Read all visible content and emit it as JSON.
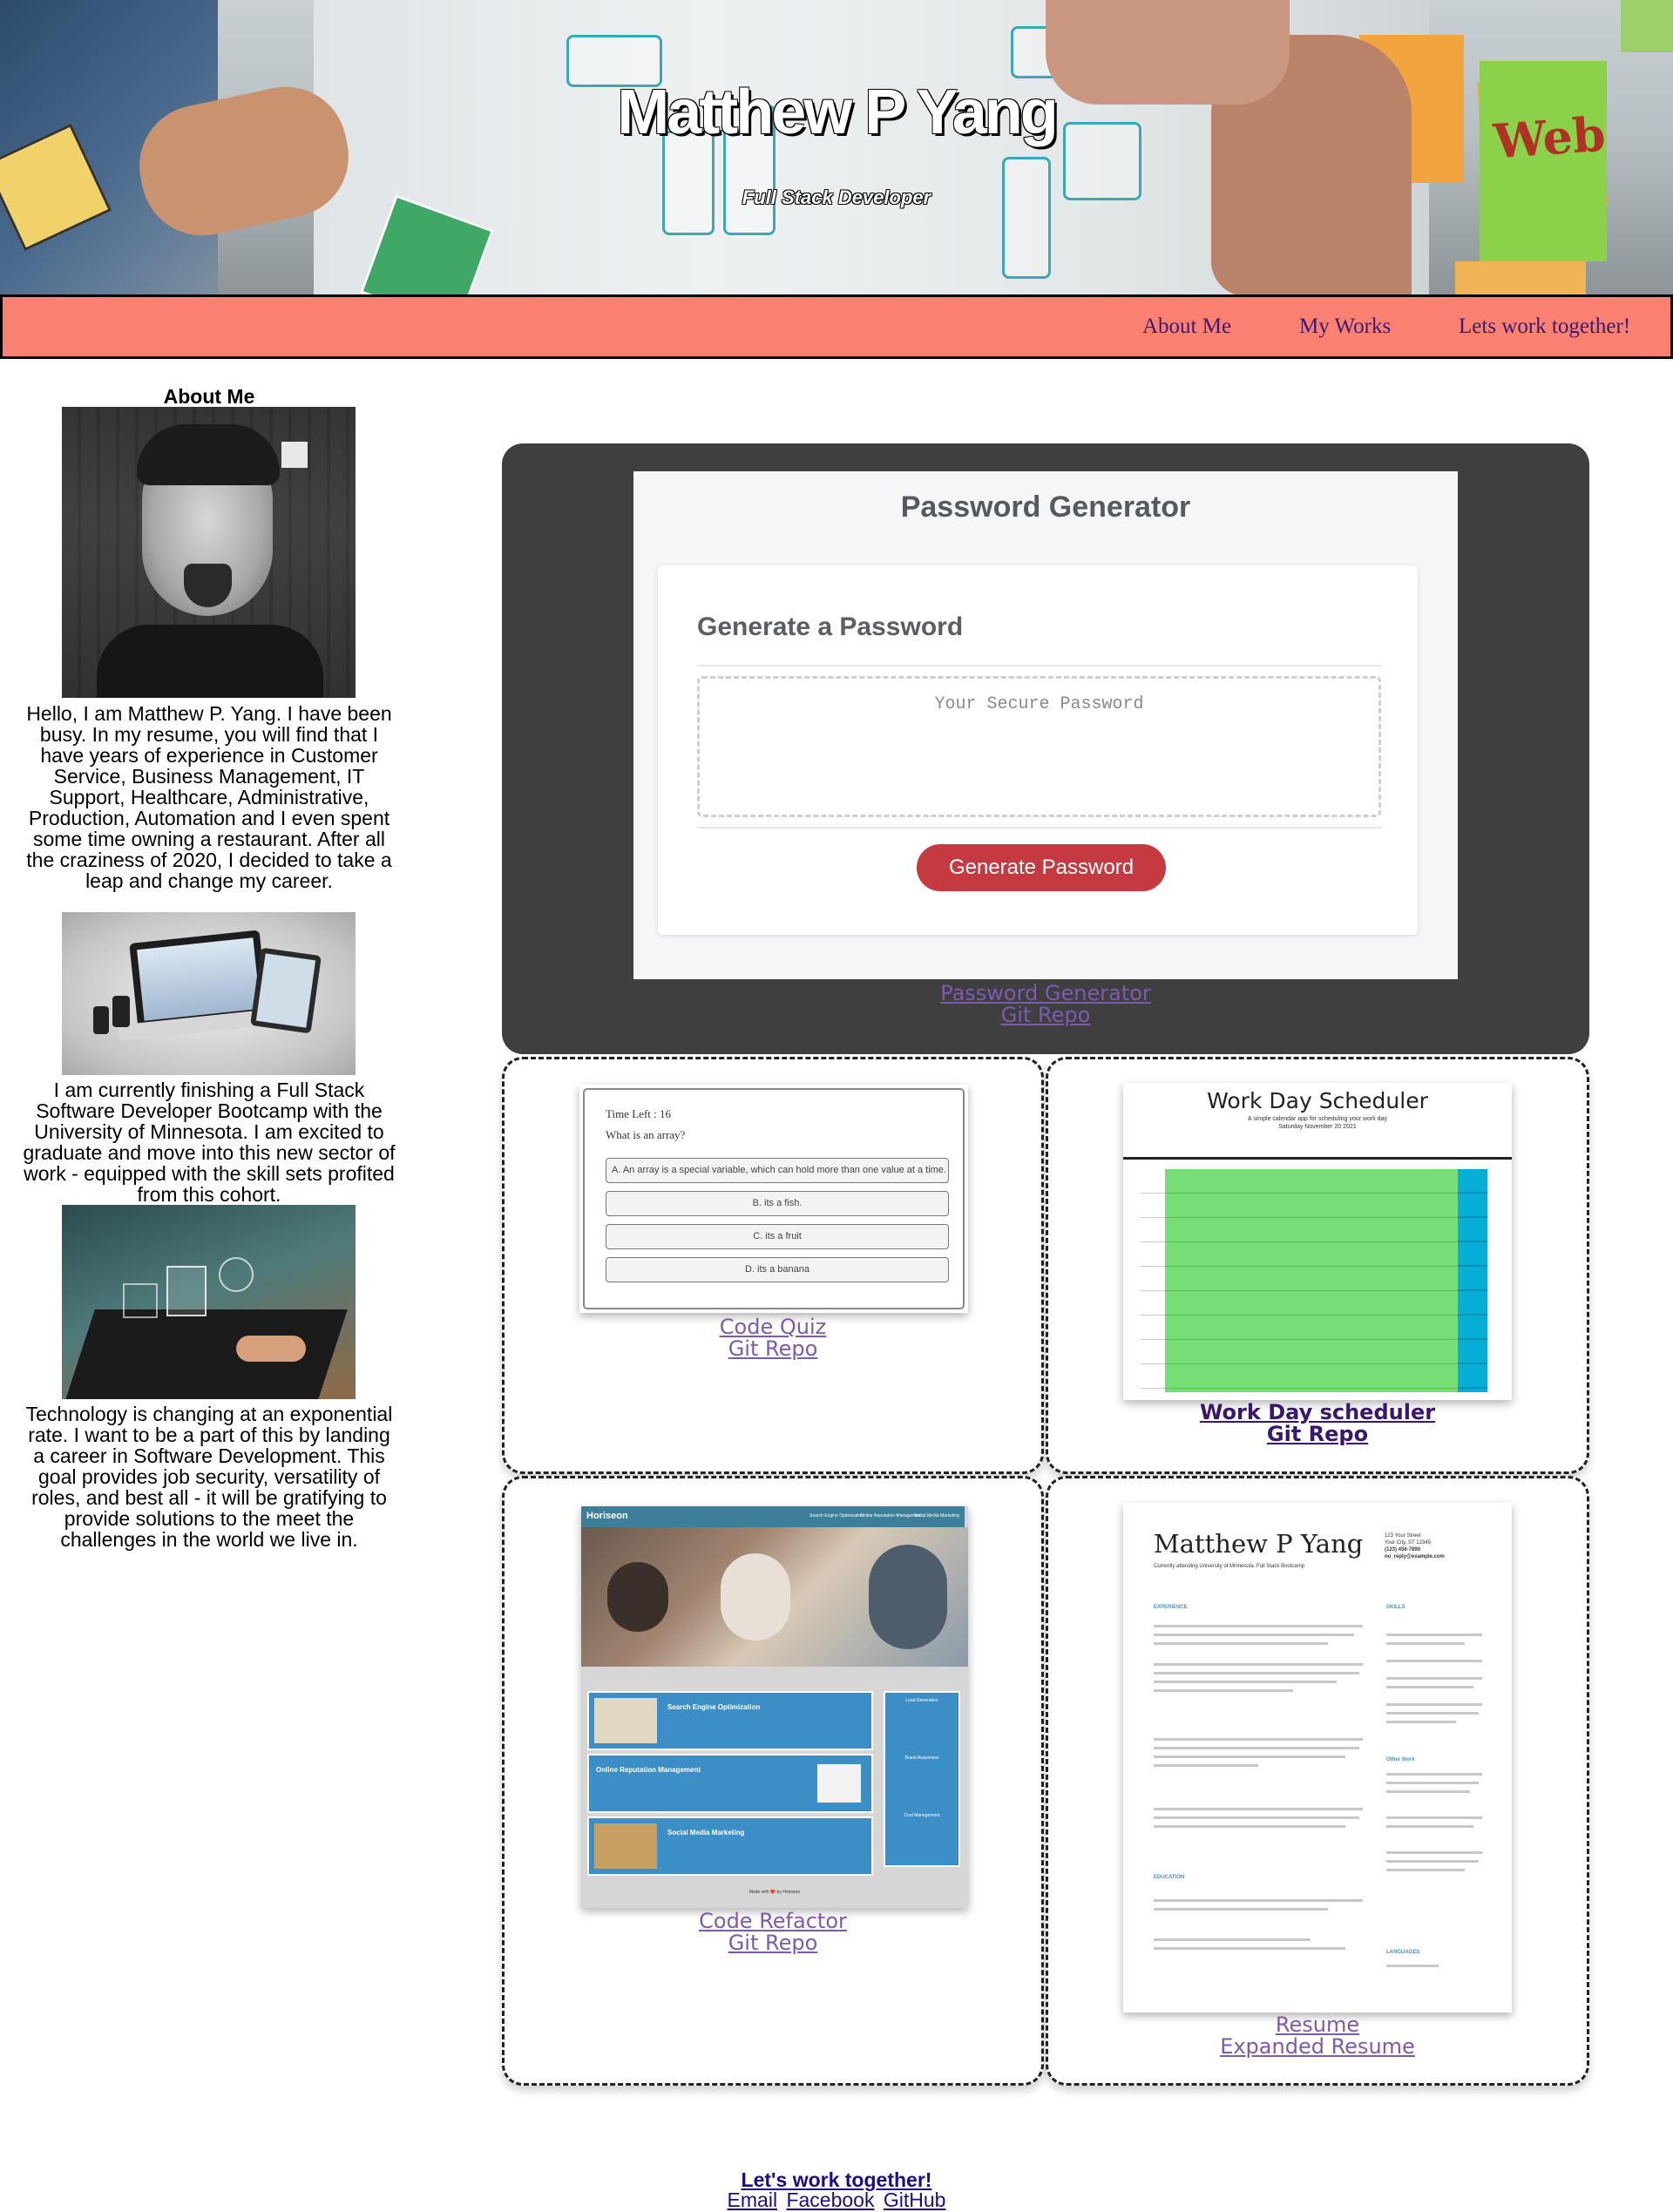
{
  "header": {
    "title": "Matthew P Yang",
    "subtitle": "Full Stack Developer",
    "sticky_note_text": "Web"
  },
  "nav": {
    "items": [
      {
        "label": "About Me"
      },
      {
        "label": "My Works"
      },
      {
        "label": "Lets work together!"
      }
    ]
  },
  "about": {
    "title": "About Me",
    "paragraphs": [
      "Hello, I am Matthew P. Yang. I have been busy. In my resume, you will find that I have years of experience in Customer Service, Business Management, IT Support, Healthcare, Administrative, Production, Automation and I even spent some time owning a restaurant. After all the craziness of 2020, I decided to take a leap and change my career.",
      "I am currently finishing a Full Stack Software Developer Bootcamp with the University of Minnesota. I am excited to graduate and move into this new sector of work - equipped with the skill sets profited from this cohort.",
      "Technology is changing at an exponential rate. I want to be a part of this by landing a career in Software Development. This goal provides job security, versatility of roles, and best all - it will be gratifying to provide solutions to the meet the challenges in the world we live in."
    ]
  },
  "password_project": {
    "screen_title": "Password Generator",
    "card_title": "Generate a Password",
    "placeholder": "Your Secure Password",
    "button": "Generate Password",
    "link_name": "Password Generator",
    "link_repo": "Git Repo"
  },
  "quiz_project": {
    "time_left": "Time Left : 16",
    "question": "What is an array?",
    "options": [
      "A. An array is a special variable, which can hold more than one value at a time.",
      "B. its a fish.",
      "C. its a fruit",
      "D. its a banana"
    ],
    "link_name": "Code Quiz",
    "link_repo": "Git Repo"
  },
  "scheduler_project": {
    "screen_title": "Work Day Scheduler",
    "screen_sub1": "A simple calendar app for scheduling your work day",
    "screen_sub2": "Saturday November 20 2021",
    "link_name": "Work Day scheduler",
    "link_repo": "Git Repo"
  },
  "refactor_project": {
    "brand": "Horiseon",
    "nav_items": [
      "Search Engine Optimization",
      "Online Reputation Management",
      "Social Media Marketing"
    ],
    "blocks": [
      "Search Engine Optimization",
      "Online Reputation Management",
      "Social Media Marketing"
    ],
    "side_items": [
      "Lead Generation",
      "Brand Awareness",
      "Cost Management"
    ],
    "footer": "Made with ❤️ by Horiseon",
    "link_name": "Code Refactor",
    "link_repo": "Git Repo"
  },
  "resume_project": {
    "name": "Matthew P Yang",
    "tagline": "Currently attending University of Minnesota. Full Stack Bootcamp",
    "contact": [
      "123 Your Street",
      "Your City, ST 12345",
      "(123) 456-7890",
      "no_reply@example.com"
    ],
    "sections": [
      "EXPERIENCE",
      "EDUCATION",
      "SKILLS",
      "Other Work",
      "LANGUAGES"
    ],
    "link_name": "Resume",
    "link_repo": "Expanded Resume"
  },
  "footer": {
    "title": "Let's work together!",
    "links": [
      "Email",
      "Facebook",
      "GitHub"
    ]
  }
}
